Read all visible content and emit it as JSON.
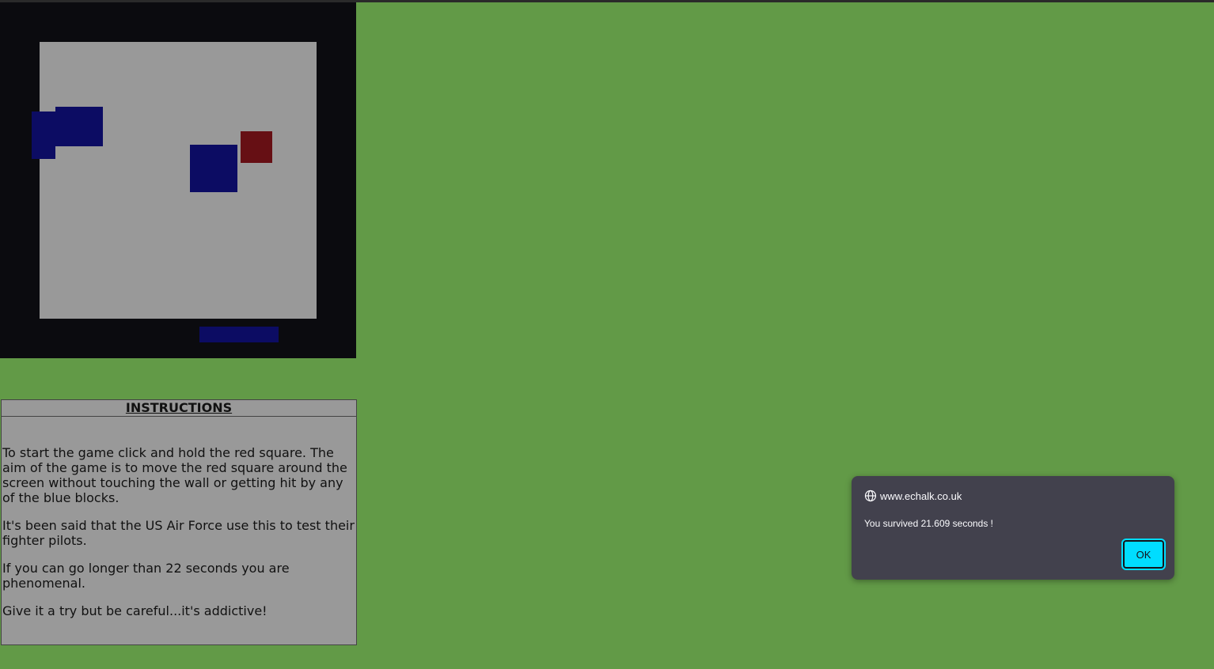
{
  "game": {
    "colors": {
      "frame": "#0b0b0f",
      "play_area": "#999999",
      "blue_block": "#0c0c63",
      "red_square": "#660f14",
      "page_background": "#629a47"
    }
  },
  "instructions": {
    "title": "INSTRUCTIONS",
    "paragraphs": [
      "To start the game click and hold the red square. The aim of the game is to move the red square around the screen without touching the wall or getting hit by any of the blue blocks.",
      "It's been said that the US Air Force use this to test their fighter pilots.",
      "If you can go longer than 22 seconds you are phenomenal.",
      "Give it a try but be careful...it's addictive!"
    ]
  },
  "alert": {
    "origin": "www.echalk.co.uk",
    "message": "You survived 21.609 seconds !",
    "ok_label": "OK",
    "globe_icon": "globe-icon",
    "accent_color": "#00ddff"
  }
}
